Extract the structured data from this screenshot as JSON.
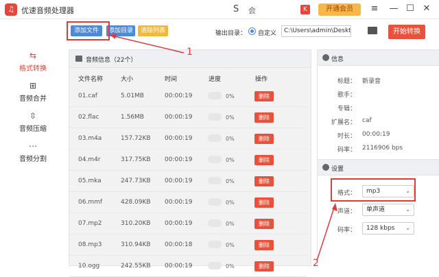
{
  "window": {
    "title": "优速音频处理器",
    "center_glyph": "S",
    "center_text": "会",
    "vip_label": "开通会员",
    "controls": [
      "≡",
      "—",
      "☐",
      "✕"
    ]
  },
  "sidebar": {
    "items": [
      {
        "label": "格式转换",
        "icon": "swap-icon",
        "glyph": "⇆",
        "active": true
      },
      {
        "label": "音频合并",
        "icon": "merge-icon",
        "glyph": "⊞",
        "active": false
      },
      {
        "label": "音频压缩",
        "icon": "compress-icon",
        "glyph": "⇳",
        "active": false
      },
      {
        "label": "音频分割",
        "icon": "split-icon",
        "glyph": "⋯",
        "active": false
      }
    ]
  },
  "toolbar": {
    "add_file": "添加文件",
    "add_dir": "添加目录",
    "clear_list": "清除列表",
    "output_label": "输出目录：",
    "radio_label": "自定义",
    "output_path": "C:\\Users\\admin\\Deskto",
    "start_label": "开始转换"
  },
  "list": {
    "header": "音频信息（22个）",
    "columns": [
      "文件名称",
      "大小",
      "时间",
      "进度",
      "操作"
    ],
    "delete_label": "删除",
    "rows": [
      {
        "name": "01.caf",
        "size": "5.01MB",
        "time": "00:00:19",
        "progress": "0%"
      },
      {
        "name": "02.flac",
        "size": "1.56MB",
        "time": "00:00:19",
        "progress": "0%"
      },
      {
        "name": "03.m4a",
        "size": "157.72KB",
        "time": "00:00:19",
        "progress": "0%"
      },
      {
        "name": "04.m4r",
        "size": "317.75KB",
        "time": "00:00:19",
        "progress": "0%"
      },
      {
        "name": "05.mka",
        "size": "247.73KB",
        "time": "00:00:19",
        "progress": "0%"
      },
      {
        "name": "06.mmf",
        "size": "428.09KB",
        "time": "00:00:19",
        "progress": "0%"
      },
      {
        "name": "07.mp2",
        "size": "310.20KB",
        "time": "00:00:19",
        "progress": "0%"
      },
      {
        "name": "08.mp3",
        "size": "310.94KB",
        "time": "00:00:18",
        "progress": "0%"
      },
      {
        "name": "10.ogg",
        "size": "242.55KB",
        "time": "00:00:19",
        "progress": "0%"
      }
    ]
  },
  "info": {
    "header": "信息",
    "fields": [
      {
        "label": "标题：",
        "value": "新录音"
      },
      {
        "label": "歌手：",
        "value": ""
      },
      {
        "label": "专辑：",
        "value": ""
      },
      {
        "label": "扩展名：",
        "value": "caf"
      },
      {
        "label": "时长：",
        "value": "00:00:19"
      },
      {
        "label": "码率：",
        "value": "2116906 bps"
      }
    ]
  },
  "settings": {
    "header": "设置",
    "format_label": "格式：",
    "format_value": "mp3",
    "channel_label": "声道：",
    "channel_value": "单声道",
    "bitrate_label": "码率：",
    "bitrate_value": "128 kbps"
  },
  "annotations": {
    "marker1": "1",
    "marker2": "2"
  },
  "colors": {
    "accent_red": "#e8523c",
    "accent_blue": "#4a89dc",
    "vip_gold": "#f7b84a",
    "annotation_red": "#e03a3a"
  }
}
